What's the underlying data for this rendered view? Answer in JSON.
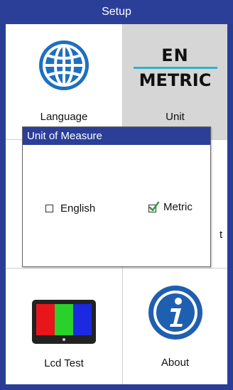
{
  "window": {
    "title": "Setup"
  },
  "tiles": {
    "language": {
      "label": "Language"
    },
    "unit": {
      "label": "Unit",
      "icon_top": "EN",
      "icon_bottom": "METRIC"
    },
    "lcd_test": {
      "label": "Lcd Test"
    },
    "about": {
      "label": "About"
    },
    "hidden_partial_char": "t"
  },
  "dialog": {
    "title": "Unit of Measure",
    "options": [
      {
        "label": "English",
        "checked": false
      },
      {
        "label": "Metric",
        "checked": true
      }
    ]
  },
  "colors": {
    "title_bar": "#2b3f99",
    "frame_border": "#2a3d96",
    "accent_cyan": "#2bb3c8",
    "check_green": "#2f9a3a",
    "unit_tile_bg": "#d6d6d6"
  },
  "icons": {
    "language": "globe-icon",
    "unit": "unit-en-metric-icon",
    "lcd_test": "monitor-rgb-icon",
    "about": "info-icon",
    "metric_check": "checkmark-icon"
  }
}
